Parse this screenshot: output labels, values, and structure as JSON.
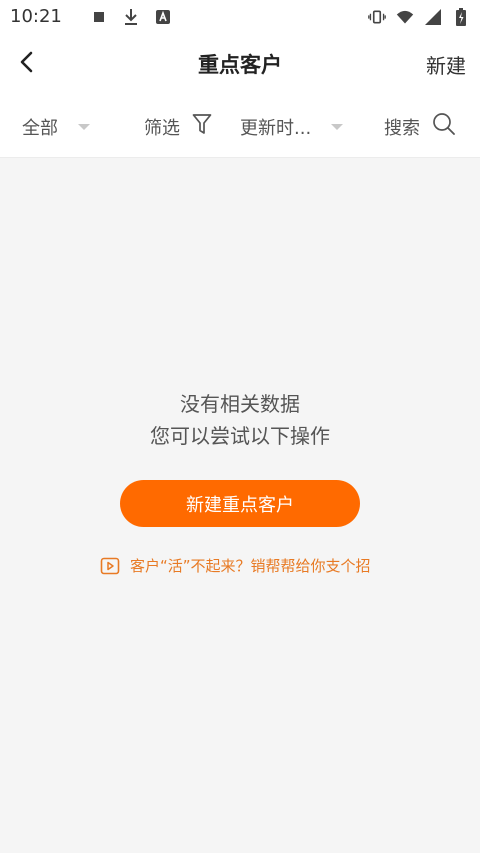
{
  "status_bar": {
    "time": "10:21",
    "left_icons": [
      "stop-square-icon",
      "download-icon",
      "text-a-icon"
    ],
    "right_icons": [
      "vibrate-icon",
      "wifi-icon",
      "signal-icon",
      "battery-charging-icon"
    ]
  },
  "nav": {
    "title": "重点客户",
    "right_action": "新建",
    "back_icon": "back-arrow-icon"
  },
  "filters": {
    "all_label": "全部",
    "filter_label": "筛选",
    "update_label": "更新时...",
    "search_label": "搜索",
    "icons": [
      "chevron-down-icon",
      "funnel-icon",
      "search-icon"
    ]
  },
  "empty_state": {
    "line1": "没有相关数据",
    "line2": "您可以尝试以下操作"
  },
  "primary_button": {
    "label": "新建重点客户"
  },
  "tip": {
    "icon": "video-play-icon",
    "text": "客户“活”不起来？销帮帮给你支个招"
  },
  "colors": {
    "accent": "#ff6a00",
    "tip_text": "#e87a24",
    "background": "#f5f5f5",
    "surface": "#ffffff"
  }
}
